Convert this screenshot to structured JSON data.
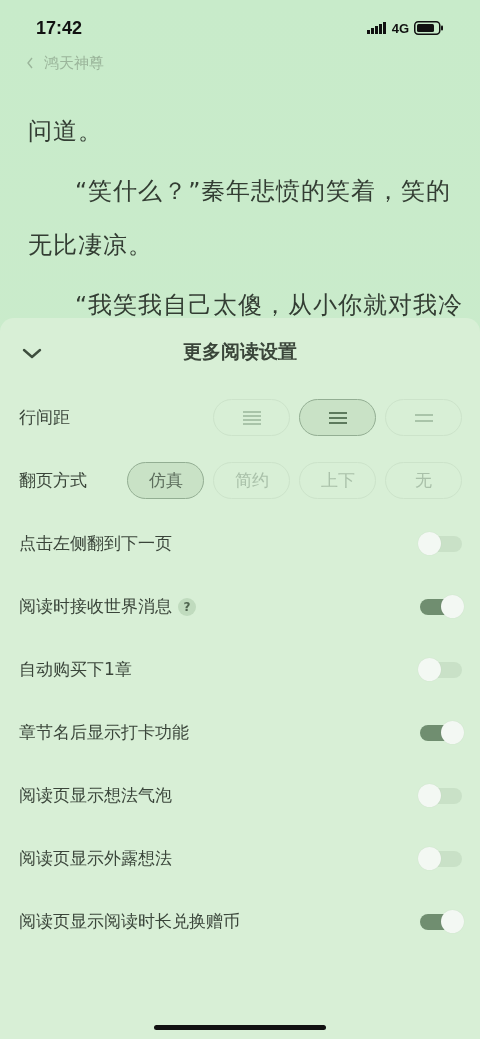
{
  "status_bar": {
    "time": "17:42",
    "network": "4G"
  },
  "reader": {
    "book_title": "鸿天神尊",
    "paragraphs": [
      {
        "text": "问道。",
        "indent": false
      },
      {
        "text": "“笑什么？”秦年悲愤的笑着，笑的无比凄凉。",
        "indent": true
      },
      {
        "text": "“我笑我自己太傻，从小你就对我冷",
        "indent": true
      }
    ]
  },
  "sheet": {
    "title": "更多阅读设置",
    "line_spacing": {
      "label": "行间距",
      "options": [
        {
          "kind": "dense",
          "selected": false
        },
        {
          "kind": "medium",
          "selected": true
        },
        {
          "kind": "loose",
          "selected": false
        }
      ]
    },
    "page_turn": {
      "label": "翻页方式",
      "options": [
        {
          "label": "仿真",
          "selected": true
        },
        {
          "label": "简约",
          "selected": false
        },
        {
          "label": "上下",
          "selected": false
        },
        {
          "label": "无",
          "selected": false
        }
      ]
    },
    "toggles": [
      {
        "label": "点击左侧翻到下一页",
        "on": false
      },
      {
        "label": "阅读时接收世界消息",
        "help": "?",
        "on": true
      },
      {
        "label": "自动购买下1章",
        "on": false
      },
      {
        "label": "章节名后显示打卡功能",
        "on": true
      },
      {
        "label": "阅读页显示想法气泡",
        "on": false
      },
      {
        "label": "阅读页显示外露想法",
        "on": false
      },
      {
        "label": "阅读页显示阅读时长兑换赠币",
        "on": true
      }
    ]
  }
}
